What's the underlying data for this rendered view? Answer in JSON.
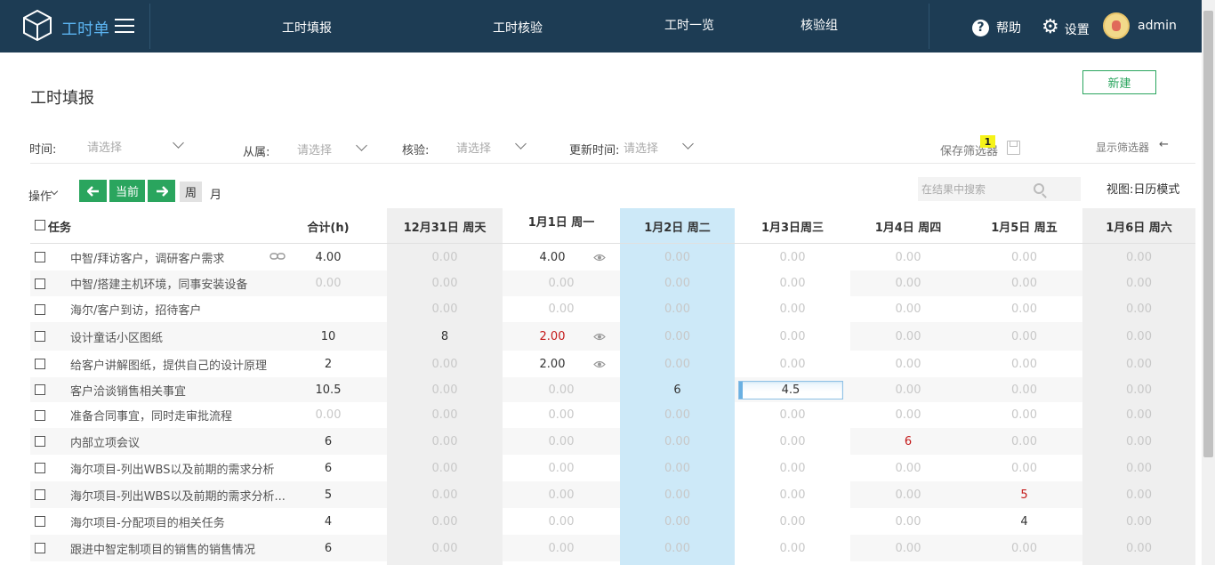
{
  "app": {
    "title": "工时单",
    "nav": [
      "工时填报",
      "工时核验",
      "工时一览",
      "核验组"
    ],
    "help": "帮助",
    "settings": "设置",
    "user": "admin"
  },
  "page": {
    "title": "工时填报",
    "new_button": "新建"
  },
  "filters": {
    "time_label": "时间:",
    "time_placeholder": "请选择",
    "belong_label": "从属:",
    "belong_placeholder": "请选择",
    "verify_label": "核验:",
    "verify_placeholder": "请选择",
    "update_label": "更新时间:",
    "update_placeholder": "请选择",
    "save_filter": "保存筛选器",
    "badge": "1",
    "show_filter": "显示筛选器"
  },
  "toolbar": {
    "ops": "操作",
    "current": "当前",
    "week": "周",
    "month": "月",
    "search_placeholder": "在结果中搜索",
    "view_mode": "视图:日历模式"
  },
  "table": {
    "task_header": "任务",
    "total_header": "合计(h)",
    "days": [
      "12月31日 周天",
      "1月1日  周一",
      "1月2日 周二",
      "1月3日周三",
      "1月4日 周四",
      "1月5日 周五",
      "1月6日 周六"
    ],
    "rows": [
      {
        "task": "中智/拜访客户，调研客户需求",
        "total": "4.00",
        "cells": [
          "0.00",
          "4.00",
          "0.00",
          "0.00",
          "0.00",
          "0.00",
          "0.00"
        ]
      },
      {
        "task": "中智/搭建主机环境，同事安装设备",
        "total": "0.00",
        "cells": [
          "0.00",
          "0.00",
          "0.00",
          "0.00",
          "0.00",
          "0.00",
          "0.00"
        ]
      },
      {
        "task": "海尔/客户到访，招待客户",
        "total": "",
        "cells": [
          "0.00",
          "0.00",
          "0.00",
          "0.00",
          "0.00",
          "0.00",
          "0.00"
        ]
      },
      {
        "task": "设计童话小区图纸",
        "total": "10",
        "cells": [
          "8",
          "2.00",
          "0.00",
          "0.00",
          "0.00",
          "0.00",
          "0.00"
        ]
      },
      {
        "task": "给客户讲解图纸，提供自己的设计原理",
        "total": "2",
        "cells": [
          "0.00",
          "2.00",
          "0.00",
          "0.00",
          "0.00",
          "0.00",
          "0.00"
        ]
      },
      {
        "task": "客户洽谈销售相关事宜",
        "total": "10.5",
        "cells": [
          "0.00",
          "0.00",
          "6",
          "4.5",
          "0.00",
          "0.00",
          "0.00"
        ]
      },
      {
        "task": "准备合同事宜，同时走审批流程",
        "total": "0.00",
        "cells": [
          "0.00",
          "0.00",
          "0.00",
          "0.00",
          "0.00",
          "0.00",
          "0.00"
        ]
      },
      {
        "task": "内部立项会议",
        "total": "6",
        "cells": [
          "0.00",
          "0.00",
          "0.00",
          "0.00",
          "6",
          "0.00",
          "0.00"
        ]
      },
      {
        "task": "海尔项目-列出WBS以及前期的需求分析",
        "total": "6",
        "cells": [
          "0.00",
          "0.00",
          "0.00",
          "0.00",
          "0.00",
          "0.00",
          "0.00"
        ]
      },
      {
        "task": "海尔项目-列出WBS以及前期的需求分析...",
        "total": "5",
        "cells": [
          "0.00",
          "0.00",
          "0.00",
          "0.00",
          "0.00",
          "5",
          "0.00"
        ]
      },
      {
        "task": "海尔项目-分配项目的相关任务",
        "total": "4",
        "cells": [
          "0.00",
          "0.00",
          "0.00",
          "0.00",
          "0.00",
          "4",
          "0.00"
        ]
      },
      {
        "task": "跟进中智定制项目的销售的销售情况",
        "total": "6",
        "cells": [
          "0.00",
          "0.00",
          "0.00",
          "0.00",
          "0.00",
          "0.00",
          "0.00"
        ]
      }
    ]
  },
  "colors": {
    "topbar": "#1d3c54",
    "accent_green": "#2aa55e",
    "today_column": "#cde9f8",
    "weekend_column": "#efefef",
    "highlight_red": "#c41a1a"
  }
}
